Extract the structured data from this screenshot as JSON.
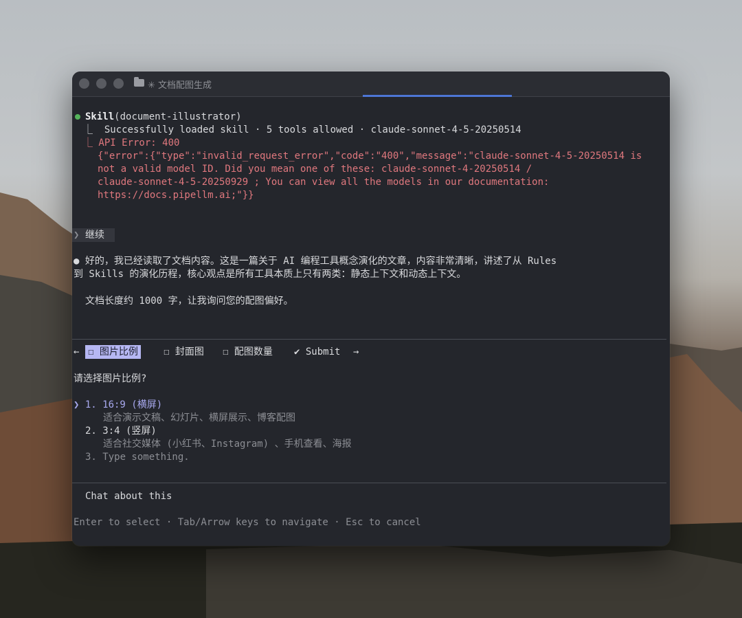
{
  "window": {
    "title": "✳ 文档配图生成"
  },
  "log": {
    "skill_name": "Skill",
    "skill_arg": "(document-illustrator)",
    "loaded": "⎿  Successfully loaded skill · 5 tools allowed · claude-sonnet-4-5-20250514",
    "error_head": "⎿ API Error: 400",
    "error_lines": [
      "{\"error\":{\"type\":\"invalid_request_error\",\"code\":\"400\",\"message\":\"claude-sonnet-4-5-20250514 is",
      "not a valid model ID. Did you mean one of these: claude-sonnet-4-20250514 /",
      "claude-sonnet-4-5-20250929 ; You can view all the models in our documentation:",
      "https://docs.pipellm.ai;\"}}"
    ],
    "user_prompt": "继续",
    "reply_line1": "● 好的，我已经读取了文档内容。这是一篇关于 AI 编程工具概念演化的文章，内容非常清晰，讲述了从 Rules",
    "reply_line2": "到 Skills 的演化历程，核心观点是所有工具本质上只有两类：静态上下文和动态上下文。",
    "reply_line3": "文档长度约 1000 字，让我询问您的配图偏好。"
  },
  "question": {
    "tabs": {
      "left_arrow": "←",
      "tab1": "☐ 图片比例",
      "tab2": "☐ 封面图",
      "tab3": "☐ 配图数量",
      "submit": "✔ Submit",
      "right_arrow": "→"
    },
    "prompt": "请选择图片比例?",
    "options": [
      {
        "label": "❯ 1. 16:9 (横屏)",
        "desc": "适合演示文稿、幻灯片、横屏展示、博客配图"
      },
      {
        "label": "2. 3:4 (竖屏)",
        "desc": "适合社交媒体 (小红书、Instagram) 、手机查看、海报"
      },
      {
        "label": "3. Type something.",
        "desc": ""
      }
    ],
    "chat": "Chat about this",
    "hint": "Enter to select · Tab/Arrow keys to navigate · Esc to cancel"
  },
  "colors": {
    "accent": "#4d76d6",
    "error": "#e0787e",
    "selected_tab": "#b6b7f3",
    "status_dot": "#55b35b"
  }
}
